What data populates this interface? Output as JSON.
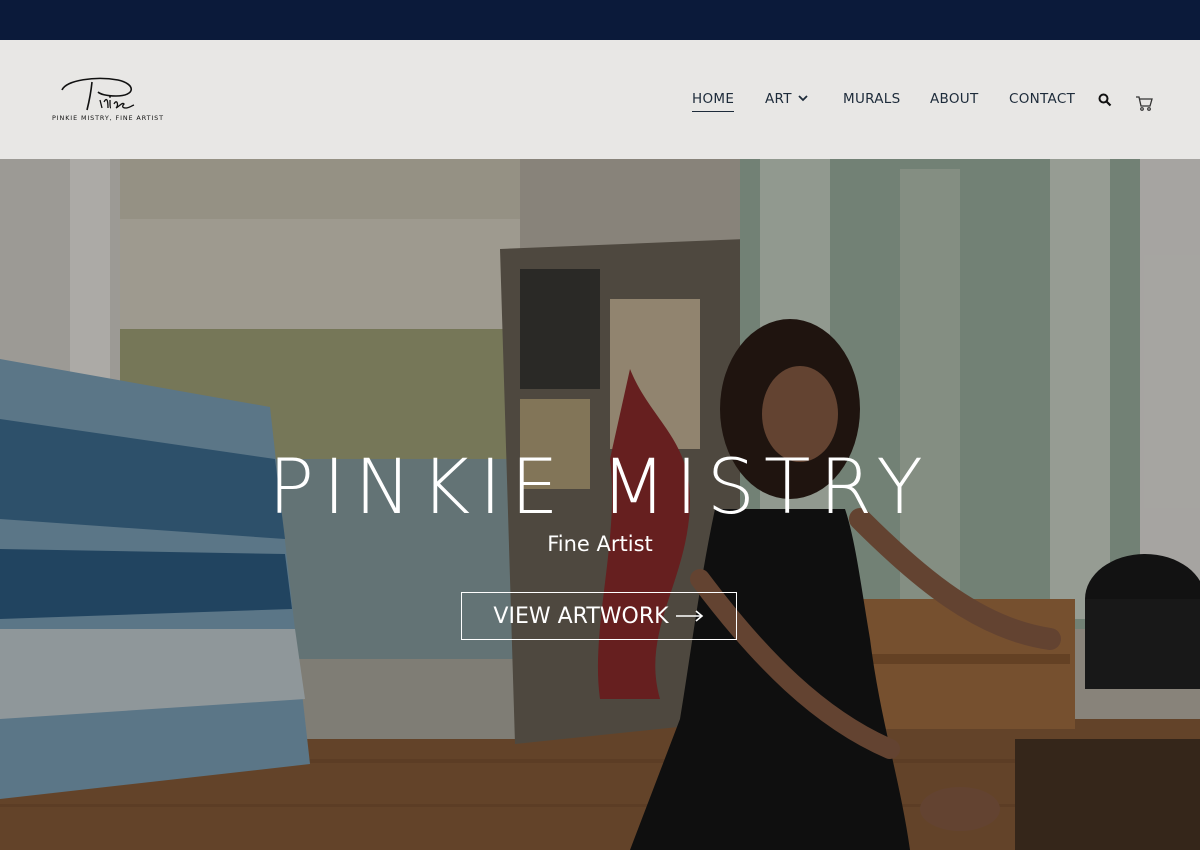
{
  "brand": {
    "signature": "Pinkie",
    "tagline": "PINKIE MISTRY, FINE ARTIST"
  },
  "nav": {
    "items": [
      {
        "label": "HOME",
        "active": true
      },
      {
        "label": "ART",
        "has_dropdown": true
      },
      {
        "label": "MURALS"
      },
      {
        "label": "ABOUT"
      },
      {
        "label": "CONTACT"
      }
    ],
    "search_icon": "search-icon",
    "cart_icon": "cart-icon"
  },
  "hero": {
    "title": "PINKIE MISTRY",
    "subtitle": "Fine Artist",
    "button_label": "VIEW ARTWORK",
    "button_icon": "arrow-right-icon"
  },
  "colors": {
    "topbar": "#0b1a3a",
    "header_bg": "#e8e7e5",
    "nav_text": "#1d2b3a",
    "hero_text": "#ffffff"
  }
}
